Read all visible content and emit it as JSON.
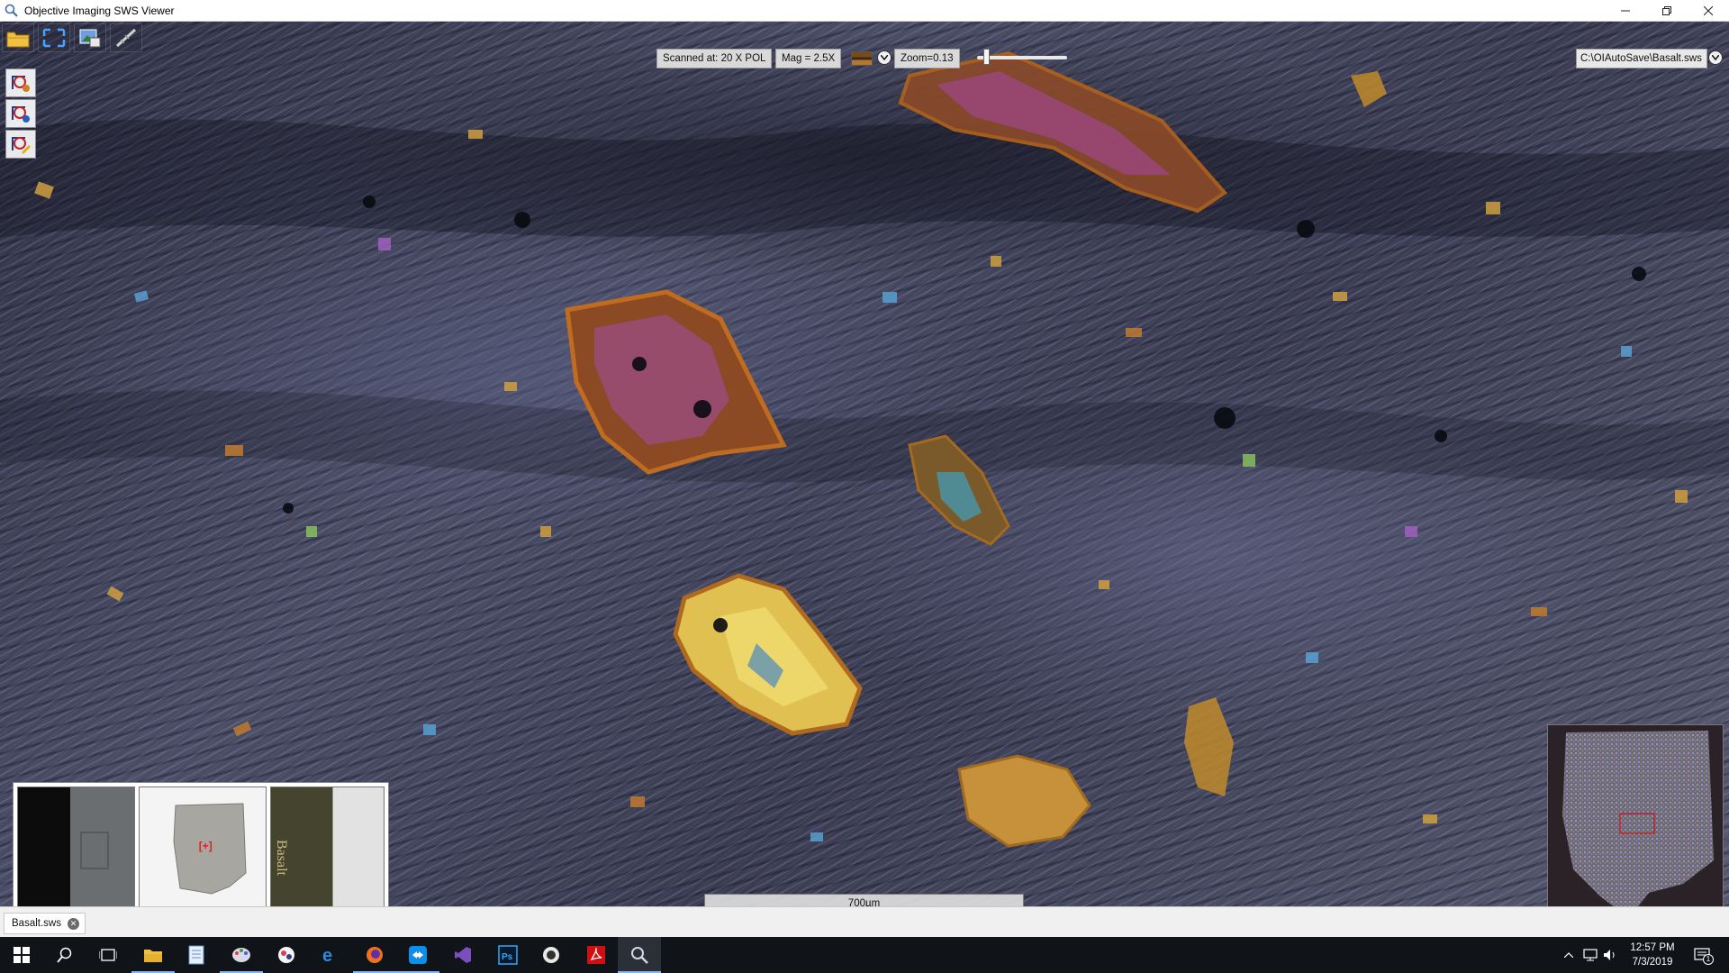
{
  "window": {
    "title": "Objective Imaging SWS Viewer",
    "controls": [
      "minimize",
      "restore",
      "close"
    ]
  },
  "toolbar": {
    "top_icons": [
      "open-folder-icon",
      "fit-to-window-icon",
      "image-export-icon",
      "measure-tool-icon"
    ],
    "side_icons": [
      "annotation-add-icon",
      "annotation-info-icon",
      "annotation-edit-icon"
    ]
  },
  "info": {
    "scanned_at": "Scanned at: 20 X POL",
    "mag": "Mag = 2.5X",
    "zoom": "Zoom=0.13",
    "zoom_slider_fraction": 0.1,
    "file_path": "C:\\OIAutoSave\\Basalt.sws"
  },
  "labels": {
    "slide_marker": "[+]",
    "label_text": "Basalt"
  },
  "scalebar": {
    "label": "700µm"
  },
  "tabs": [
    {
      "label": "Basalt.sws"
    }
  ],
  "taskbar": {
    "items": [
      "start-icon",
      "search-icon",
      "task-view-icon",
      "file-explorer-icon",
      "notepad-icon",
      "paint-app-icon",
      "color-app-icon",
      "edge-icon",
      "firefox-icon",
      "teamviewer-icon",
      "visual-studio-icon",
      "photoshop-icon",
      "obs-icon",
      "acrobat-icon",
      "sws-viewer-icon"
    ],
    "active_item": "sws-viewer-icon",
    "time": "12:57 PM",
    "date": "7/3/2019",
    "notification_count": "1"
  },
  "colors": {
    "accent": "#0078d7",
    "readout_bg": "#d9d9d9",
    "taskbar_bg": "#101318",
    "minimap_roi": "#d01010"
  }
}
